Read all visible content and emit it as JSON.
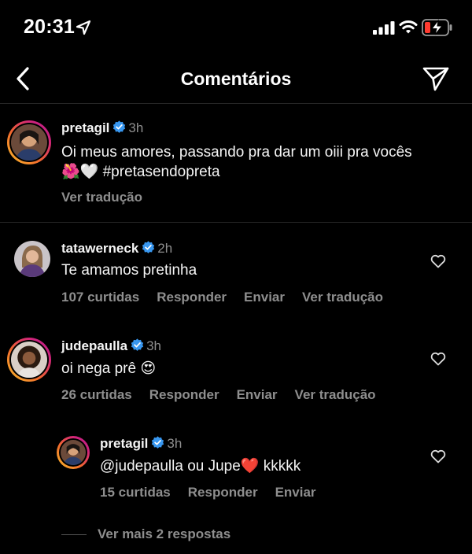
{
  "status_bar": {
    "time": "20:31",
    "icons": [
      "location-arrow-icon",
      "signal-icon",
      "wifi-icon",
      "battery-low-charging-icon"
    ],
    "battery_color": "#ff3b30"
  },
  "nav": {
    "title": "Comentários",
    "back_icon": "chevron-left-icon",
    "share_icon": "paper-plane-icon"
  },
  "caption": {
    "username": "pretagil",
    "verified": true,
    "time": "3h",
    "text_line1": "Oi meus amores, passando pra dar um oiii pra vocês",
    "text_line2_emojis": "🌺🤍",
    "hashtag": "#pretasendopreta",
    "translate": "Ver tradução"
  },
  "comments": [
    {
      "username": "tatawerneck",
      "verified": true,
      "time": "2h",
      "text": "Te amamos pretinha",
      "likes": "107 curtidas",
      "reply": "Responder",
      "send": "Enviar",
      "translate": "Ver tradução"
    },
    {
      "username": "judepaulla",
      "verified": true,
      "time": "3h",
      "text": "oi nega prê",
      "emoji": "😍",
      "likes": "26 curtidas",
      "reply": "Responder",
      "send": "Enviar",
      "translate": "Ver tradução"
    }
  ],
  "reply": {
    "username": "pretagil",
    "verified": true,
    "time": "3h",
    "text_part1": "@judepaulla ou Jupe",
    "emoji": "❤️",
    "text_part2": "kkkkk",
    "likes": "15 curtidas",
    "reply": "Responder",
    "send": "Enviar"
  },
  "more_replies": "Ver mais 2 respostas",
  "colors": {
    "background": "#000000",
    "text": "#f5f5f5",
    "muted": "#8e8e8e",
    "verified": "#3897f0",
    "divider": "#262626"
  }
}
